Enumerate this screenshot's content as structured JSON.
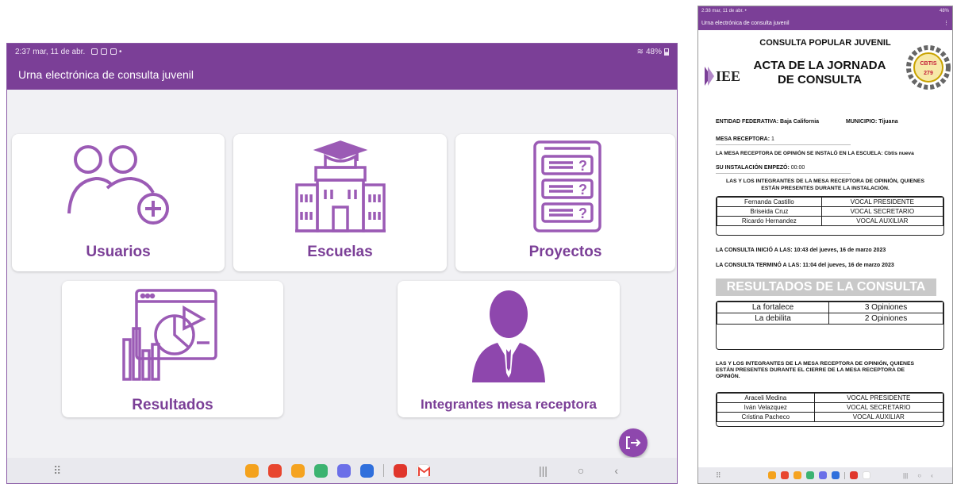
{
  "left": {
    "status": {
      "time": "2:37",
      "date": "mar, 11 de abr.",
      "dot": "•",
      "battery": "48%"
    },
    "app_title": "Urna electrónica de consulta juvenil",
    "cards": {
      "usuarios": "Usuarios",
      "escuelas": "Escuelas",
      "proyectos": "Proyectos",
      "resultados": "Resultados",
      "integrantes": "Integrantes mesa receptora"
    },
    "nav": {
      "apps": "⠿",
      "recents": "|||",
      "home": "○",
      "back": "‹"
    }
  },
  "right": {
    "status": {
      "time": "2:38",
      "date": "mar, 11 de abr.",
      "dot": "•",
      "battery": "48%"
    },
    "app_title": "Urna electrónica de consulta juvenil",
    "menu": "⋮",
    "doc": {
      "title_top": "CONSULTA POPULAR JUVENIL",
      "title_main": "ACTA DE LA JORNADA DE CONSULTA",
      "logo_left": "IEE",
      "logo_right": "CBTIS 279",
      "entidad_label": "ENTIDAD FEDERATIVA:",
      "entidad_value": "Baja California",
      "municipio_label": "MUNICIPIO:",
      "municipio_value": "Tijuana",
      "mesa_label": "MESA RECEPTORA:",
      "mesa_value": "1",
      "escuela_text": "LA MESA RECEPTORA DE OPINIÓN SE INSTALÓ EN LA ESCUELA:",
      "escuela_value": "Cbtis nueva",
      "inst_label": "SU INSTALACIÓN EMPEZÓ:",
      "inst_value": "00:00",
      "integrantes_head_1": "LAS Y LOS INTEGRANTES DE LA MESA RECEPTORA DE OPINIÓN, QUIENES",
      "integrantes_head_2": "ESTÁN PRESENTES DURANTE LA INSTALACIÓN.",
      "integrantes_inst": [
        {
          "name": "Fernanda Castillo",
          "role": "VOCAL PRESIDENTE"
        },
        {
          "name": "Briseida  Cruz",
          "role": "VOCAL SECRETARIO"
        },
        {
          "name": "Ricardo Hernandez",
          "role": "VOCAL AUXILIAR"
        }
      ],
      "inicio_label": "LA CONSULTA INICIÓ A LAS:",
      "inicio_value": "10:43 del jueves, 16 de marzo 2023",
      "termino_label": "LA CONSULTA TERMINÓ A LAS:",
      "termino_value": "11:04 del jueves, 16 de marzo 2023",
      "resultados_title": "RESULTADOS DE LA CONSULTA",
      "resultados": [
        {
          "option": "La fortalece",
          "count": "3 Opiniones"
        },
        {
          "option": "La debilita",
          "count": "2 Opiniones"
        }
      ],
      "cierre_head_1": "LAS Y LOS INTEGRANTES DE LA MESA RECEPTORA DE OPINIÓN, QUIENES",
      "cierre_head_2": "ESTÁN PRESENTES DURANTE EL CIERRE DE LA MESA RECEPTORA DE",
      "cierre_head_3": "OPINIÓN.",
      "integrantes_cierre": [
        {
          "name": "Araceli Medina",
          "role": "VOCAL PRESIDENTE"
        },
        {
          "name": "Iván Velazquez",
          "role": "VOCAL SECRETARIO"
        },
        {
          "name": "Cristina Pacheco",
          "role": "VOCAL AUXILIAR"
        }
      ]
    },
    "nav": {
      "apps": "⠿",
      "recents": "|||",
      "home": "○",
      "back": "‹"
    }
  },
  "colors": {
    "primary": "#7b3f97",
    "icon": "#9b5bb5",
    "fab": "#8e47ad",
    "result_bar": "#c9c9c9"
  },
  "dock_apps": [
    {
      "name": "app-orange",
      "color": "#f4a21d"
    },
    {
      "name": "app-red",
      "color": "#e8462f"
    },
    {
      "name": "app-contacts",
      "color": "#f5a320"
    },
    {
      "name": "app-calculator",
      "color": "#3cb371"
    },
    {
      "name": "app-messages",
      "color": "#6b6fe8"
    },
    {
      "name": "app-calendar",
      "color": "#2f6fdc"
    },
    {
      "name": "app-pdf",
      "color": "#e0362c"
    },
    {
      "name": "app-gmail",
      "color": "#ea4335"
    }
  ]
}
